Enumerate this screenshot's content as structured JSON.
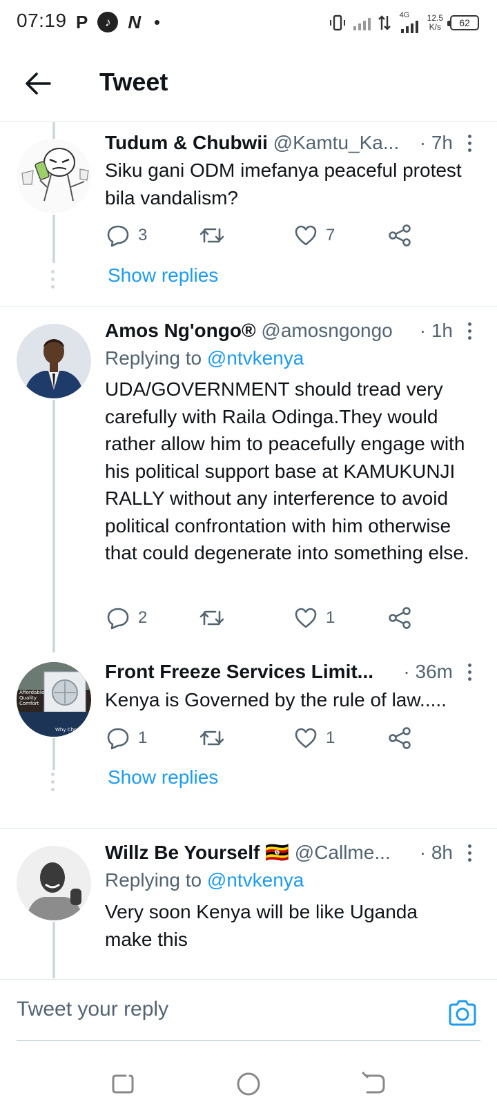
{
  "status_bar": {
    "time": "07:19",
    "icons_left": [
      "p-icon",
      "tiktok-icon",
      "n-icon",
      "dot-icon"
    ],
    "net_speed": "12.5",
    "net_unit": "K/s",
    "network": "4G",
    "battery": "62"
  },
  "header": {
    "title": "Tweet"
  },
  "tweets": [
    {
      "name": "Tudum & Chubwii",
      "handle": "@Kamtu_Ka...",
      "time": "· 7h",
      "body": "Siku gani ODM imefanya peaceful protest bila vandalism?",
      "replies": "3",
      "likes": "7",
      "show_replies": "Show replies"
    },
    {
      "name": "Amos Ng'ongo®",
      "handle": "@amosngongo",
      "time": "· 1h",
      "replying_prefix": "Replying to",
      "replying_to": "@ntvkenya",
      "body": "UDA/GOVERNMENT should tread very carefully with Raila Odinga.They would rather allow him to peacefully engage with his political support base at KAMUKUNJI RALLY without any interference to avoid political confrontation with him otherwise that could degenerate into something else.",
      "replies": "2",
      "likes": "1"
    },
    {
      "name": "Front Freeze Services Limit...",
      "time": "· 36m",
      "body": "Kenya is Governed by the rule of law.....",
      "replies": "1",
      "likes": "1",
      "show_replies": "Show replies",
      "avatar_text_1": "Affordable",
      "avatar_text_2": "Quality",
      "avatar_text_3": "Comfort",
      "avatar_text_4": "Why Choo"
    },
    {
      "name": "Willz Be Yourself",
      "flag": "🇺🇬",
      "handle": "@Callme...",
      "time": "· 8h",
      "replying_prefix": "Replying to",
      "replying_to": "@ntvkenya",
      "body": "Very soon Kenya will be like Uganda make this"
    }
  ],
  "reply_bar": {
    "placeholder": "Tweet your reply"
  },
  "colors": {
    "accent": "#1d9bf0",
    "text": "#0f1419",
    "secondary": "#536471",
    "thread_line": "#cfd9de"
  }
}
